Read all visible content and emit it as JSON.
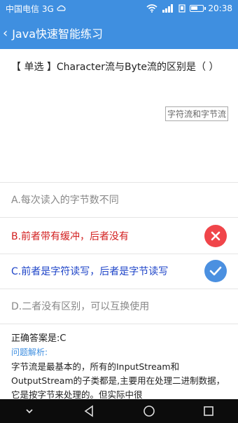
{
  "status": {
    "carrier": "中国电信 3G",
    "time": "20:38",
    "icons": [
      "signal-icon",
      "wifi-icon",
      "data-icon",
      "battery-icon"
    ],
    "battery_level": 0.6
  },
  "appbar": {
    "back_icon": "‹",
    "title": "Java快速智能练习"
  },
  "question": {
    "text": "【 单选 】Character流与Byte流的区别是（ ）",
    "tag": "字符流和字节流"
  },
  "options": [
    {
      "label": "A.每次读入的字节数不同",
      "state": "normal"
    },
    {
      "label": "B.前者带有缓冲，后者没有",
      "state": "wrong"
    },
    {
      "label": "C.前者是字符读写，后者是字节读写",
      "state": "correct"
    },
    {
      "label": "D.二者没有区别，可以互换使用",
      "state": "normal"
    }
  ],
  "answer": {
    "text": "正确答案是:C",
    "analysis_title": "问题解析:",
    "analysis_text": "字节流是最基本的，所有的InputStream和OutputStream的子类都是,主要用在处理二进制数据，它是按字节来处理的。但实际中很"
  },
  "navbar": {
    "icons": [
      "chevron-down-icon",
      "back-triangle-icon",
      "home-circle-icon",
      "recent-square-icon"
    ]
  },
  "colors": {
    "primary": "#3f8fe0",
    "wrong": "#d21e1e",
    "correct": "#1e44c8"
  }
}
